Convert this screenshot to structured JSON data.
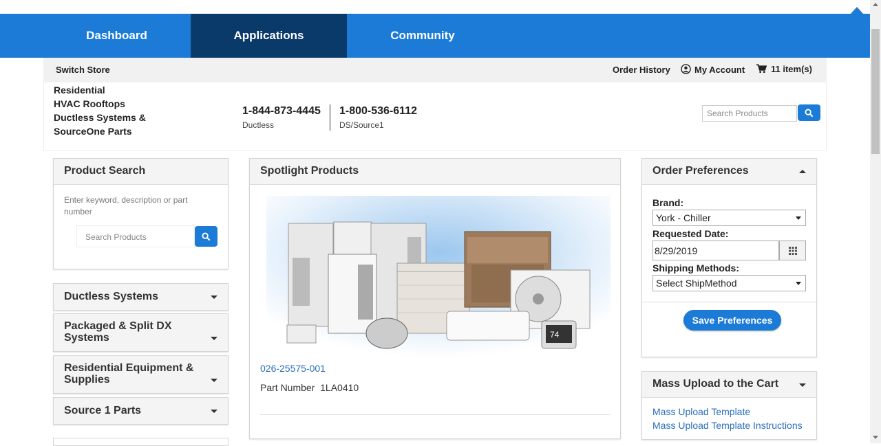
{
  "nav": {
    "tabs": [
      {
        "label": "Dashboard",
        "active": false
      },
      {
        "label": "Applications",
        "active": true
      },
      {
        "label": "Community",
        "active": false
      }
    ]
  },
  "subbar": {
    "switch_store": "Switch Store",
    "order_history": "Order History",
    "my_account": "My Account",
    "cart": "11 item(s)"
  },
  "header": {
    "brand_lines": [
      "Residential",
      "HVAC Rooftops",
      "Ductless Systems &",
      "SourceOne Parts"
    ],
    "phones": [
      {
        "number": "1-844-873-4445",
        "label": "Ductless"
      },
      {
        "number": "1-800-536-6112",
        "label": "DS/Source1"
      }
    ],
    "search_placeholder": "Search Products"
  },
  "product_search": {
    "title": "Product Search",
    "hint": "Enter keyword, description or part number",
    "placeholder": "Search Products"
  },
  "categories": [
    "Ductless Systems",
    "Packaged & Split DX Systems",
    "Residential Equipment & Supplies",
    "Source 1 Parts"
  ],
  "spotlight": {
    "title": "Spotlight Products",
    "product_link": "026-25575-001",
    "part_label": "Part Number",
    "part_number": "1LA0410",
    "thermostat_reading": "74"
  },
  "order_prefs": {
    "title": "Order Preferences",
    "brand_label": "Brand:",
    "brand_value": "York - Chiller",
    "date_label": "Requested Date:",
    "date_value": "8/29/2019",
    "ship_label": "Shipping Methods:",
    "ship_value": "Select ShipMethod",
    "save_label": "Save Preferences"
  },
  "mass_upload": {
    "title": "Mass Upload to the Cart",
    "links": [
      "Mass Upload Template",
      "Mass Upload Template Instructions"
    ]
  },
  "colors": {
    "primary": "#1b7bd6",
    "nav_active": "#0a3a69",
    "link": "#2a6ebb"
  }
}
